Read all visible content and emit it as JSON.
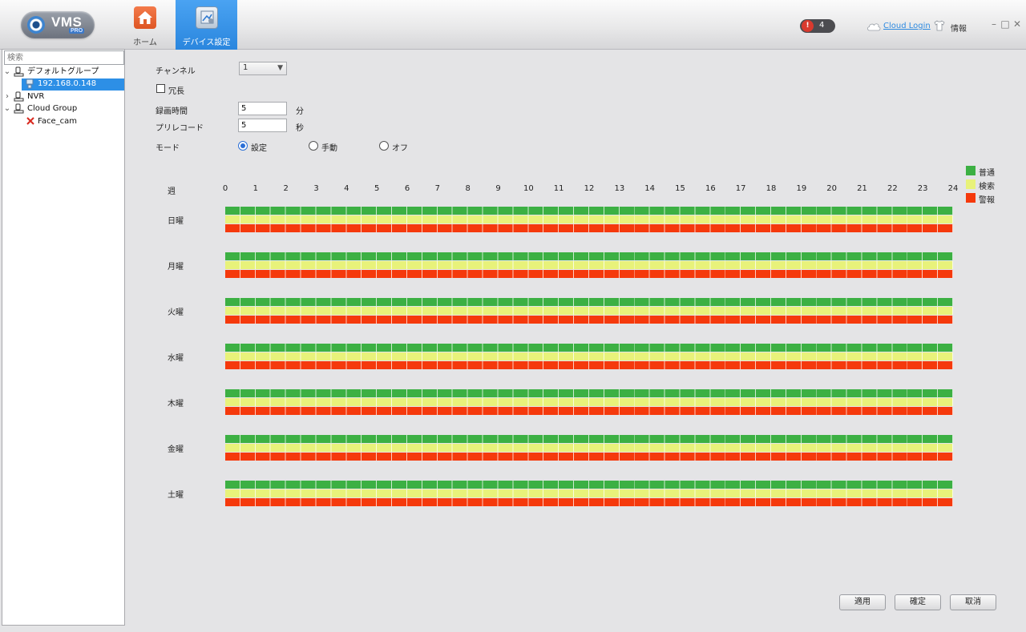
{
  "app": {
    "logo_text": "VMS",
    "logo_sub": "PRO"
  },
  "nav": {
    "home_label": "ホーム",
    "device_label": "デバイス設定"
  },
  "header": {
    "alarm_count": "4",
    "cloud_login": "Cloud Login",
    "info_label": "情報"
  },
  "window_controls": {
    "minimize": "–",
    "maximize": "□",
    "close": "✕"
  },
  "sidebar": {
    "search_placeholder": "検索",
    "tree": [
      {
        "label": "デフォルトグループ",
        "expanded": true,
        "icon": "group-icon"
      },
      {
        "label": "192.168.0.148",
        "selected": true,
        "icon": "camera-icon"
      },
      {
        "label": "NVR",
        "expanded": false,
        "icon": "group-icon"
      },
      {
        "label": "Cloud Group",
        "expanded": true,
        "icon": "group-icon"
      },
      {
        "label": "Face_cam",
        "icon": "camera-offline-icon"
      }
    ]
  },
  "form": {
    "channel_label": "チャンネル",
    "channel_value": "1",
    "redundant_label": "冗長",
    "redundant_checked": false,
    "record_time_label": "録画時間",
    "record_time_value": "5",
    "record_time_unit": "分",
    "prerecord_label": "プリレコード",
    "prerecord_value": "5",
    "prerecord_unit": "秒",
    "mode_label": "モード",
    "modes": [
      {
        "label": "設定",
        "checked": true
      },
      {
        "label": "手動",
        "checked": false
      },
      {
        "label": "オフ",
        "checked": false
      }
    ]
  },
  "schedule": {
    "week_label": "週",
    "hours": [
      "0",
      "1",
      "2",
      "3",
      "4",
      "5",
      "6",
      "7",
      "8",
      "9",
      "10",
      "11",
      "12",
      "13",
      "14",
      "15",
      "16",
      "17",
      "18",
      "19",
      "20",
      "21",
      "22",
      "23",
      "24"
    ],
    "days": [
      "日曜",
      "月曜",
      "火曜",
      "水曜",
      "木曜",
      "金曜",
      "土曜"
    ],
    "legend": [
      {
        "label": "普通",
        "color": "#3cb043"
      },
      {
        "label": "検索",
        "color": "#e8f27a"
      },
      {
        "label": "警報",
        "color": "#f5390c"
      }
    ],
    "enabled_fraction": 1.0
  },
  "buttons": {
    "apply": "適用",
    "ok": "確定",
    "cancel": "取消"
  }
}
